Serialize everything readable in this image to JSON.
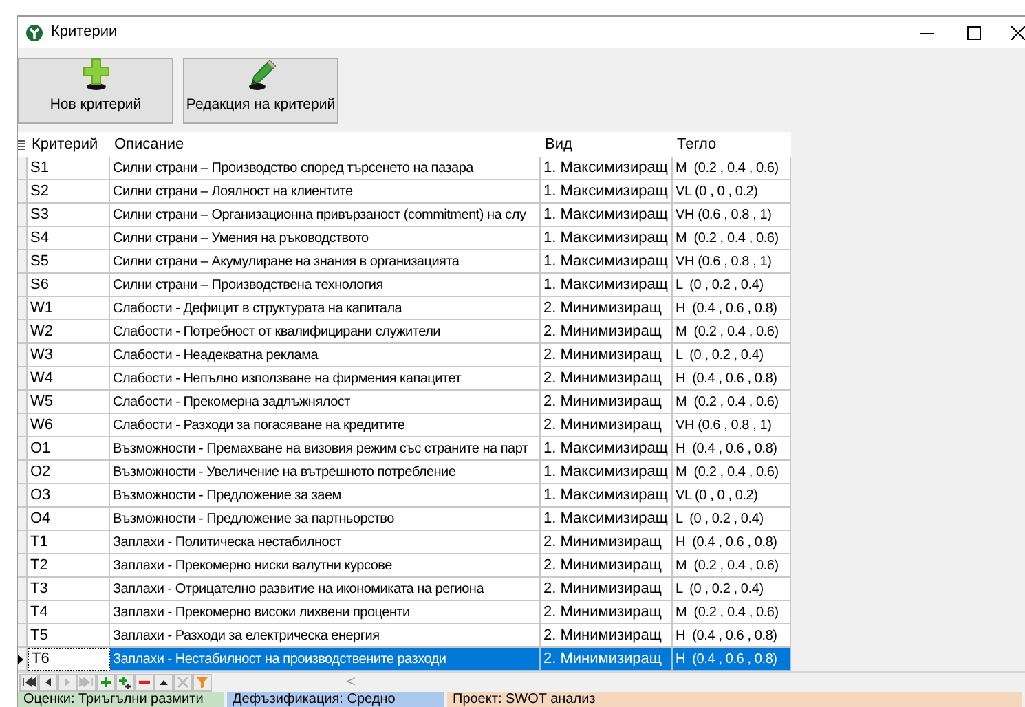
{
  "window": {
    "title": "Критерии"
  },
  "toolbar": [
    {
      "kind": "add",
      "label": "Нов критерий"
    },
    {
      "kind": "edit",
      "label": "Редакция на критерий"
    }
  ],
  "table": {
    "columns": [
      "Критерий",
      "Описание",
      "Вид",
      "Тегло"
    ],
    "rows": [
      {
        "cells": [
          "S1",
          "Силни страни – Производство според търсенето на пазара",
          "1. Максимизиращ",
          "M  (0.2 , 0.4 , 0.6)"
        ],
        "selected": false
      },
      {
        "cells": [
          "S2",
          "Силни страни – Лоялност на клиентите",
          "1. Максимизиращ",
          "VL (0 , 0 , 0.2)"
        ],
        "selected": false
      },
      {
        "cells": [
          "S3",
          "Силни страни – Организационна привързаност (commitment) на слу",
          "1. Максимизиращ",
          "VH (0.6 , 0.8 , 1)"
        ],
        "selected": false
      },
      {
        "cells": [
          "S4",
          "Силни страни – Умения на ръководството",
          "1. Максимизиращ",
          "M  (0.2 , 0.4 , 0.6)"
        ],
        "selected": false
      },
      {
        "cells": [
          "S5",
          "Силни страни – Акумулиране на знания в организацията",
          "1. Максимизиращ",
          "VH (0.6 , 0.8 , 1)"
        ],
        "selected": false
      },
      {
        "cells": [
          "S6",
          "Силни страни – Производствена технология",
          "1. Максимизиращ",
          "L  (0 , 0.2 , 0.4)"
        ],
        "selected": false
      },
      {
        "cells": [
          "W1",
          "Слабости - Дефицит в структурата на капитала",
          "2. Минимизиращ",
          "H  (0.4 , 0.6 , 0.8)"
        ],
        "selected": false
      },
      {
        "cells": [
          "W2",
          "Слабости - Потребност от квалифицирани служители",
          "2. Минимизиращ",
          "M  (0.2 , 0.4 , 0.6)"
        ],
        "selected": false
      },
      {
        "cells": [
          "W3",
          "Слабости - Неадекватна реклама",
          "2. Минимизиращ",
          "L  (0 , 0.2 , 0.4)"
        ],
        "selected": false
      },
      {
        "cells": [
          "W4",
          "Слабости - Непълно използване на фирмения капацитет",
          "2. Минимизиращ",
          "H  (0.4 , 0.6 , 0.8)"
        ],
        "selected": false
      },
      {
        "cells": [
          "W5",
          "Слабости - Прекомерна задлъжнялост",
          "2. Минимизиращ",
          "M  (0.2 , 0.4 , 0.6)"
        ],
        "selected": false
      },
      {
        "cells": [
          "W6",
          "Слабости - Разходи за погасяване на кредитите",
          "2. Минимизиращ",
          "VH (0.6 , 0.8 , 1)"
        ],
        "selected": false
      },
      {
        "cells": [
          "O1",
          "Възможности - Премахване на визовия режим със страните на парт",
          "1. Максимизиращ",
          "H  (0.4 , 0.6 , 0.8)"
        ],
        "selected": false
      },
      {
        "cells": [
          "O2",
          "Възможности - Увеличение на вътрешното потребление",
          "1. Максимизиращ",
          "M  (0.2 , 0.4 , 0.6)"
        ],
        "selected": false
      },
      {
        "cells": [
          "O3",
          "Възможности - Предложение за заем",
          "1. Максимизиращ",
          "VL (0 , 0 , 0.2)"
        ],
        "selected": false
      },
      {
        "cells": [
          "O4",
          "Възможности - Предложение за партньорство",
          "1. Максимизиращ",
          "L  (0 , 0.2 , 0.4)"
        ],
        "selected": false
      },
      {
        "cells": [
          "T1",
          "Заплахи - Политическа нестабилност",
          "2. Минимизиращ",
          "H  (0.4 , 0.6 , 0.8)"
        ],
        "selected": false
      },
      {
        "cells": [
          "T2",
          "Заплахи - Прекомерно ниски валутни курсове",
          "2. Минимизиращ",
          "M  (0.2 , 0.4 , 0.6)"
        ],
        "selected": false
      },
      {
        "cells": [
          "T3",
          "Заплахи - Отрицателно развитие на икономиката на региона",
          "2. Минимизиращ",
          "L  (0 , 0.2 , 0.4)"
        ],
        "selected": false
      },
      {
        "cells": [
          "T4",
          "Заплахи - Прекомерно високи лихвени проценти",
          "2. Минимизиращ",
          "M  (0.2 , 0.4 , 0.6)"
        ],
        "selected": false
      },
      {
        "cells": [
          "T5",
          "Заплахи - Разходи за електрическа енергия",
          "2. Минимизиращ",
          "H  (0.4 , 0.6 , 0.8)"
        ],
        "selected": false
      },
      {
        "cells": [
          "T6",
          "Заплахи - Нестабилност на производствените разходи",
          "2. Минимизиращ",
          "H  (0.4 , 0.6 , 0.8)"
        ],
        "selected": true
      }
    ]
  },
  "navigator": [
    {
      "kind": "first",
      "disabled": false
    },
    {
      "kind": "prior",
      "disabled": false
    },
    {
      "kind": "next",
      "disabled": true
    },
    {
      "kind": "last",
      "disabled": true
    },
    {
      "kind": "insert",
      "disabled": false
    },
    {
      "kind": "append",
      "disabled": false
    },
    {
      "kind": "delete",
      "disabled": false
    },
    {
      "kind": "post",
      "disabled": false
    },
    {
      "kind": "cancel",
      "disabled": true
    },
    {
      "kind": "filter",
      "disabled": false
    }
  ],
  "scroll_left": "<",
  "status_bar": [
    {
      "text": "Оценки: Триъгълни размити",
      "color": "#c6e0c4"
    },
    {
      "text": "Дефъзификация: Средно",
      "color": "#abc9ee"
    },
    {
      "text": "Проект: SWOT анализ",
      "color": "#f5d7be"
    }
  ]
}
